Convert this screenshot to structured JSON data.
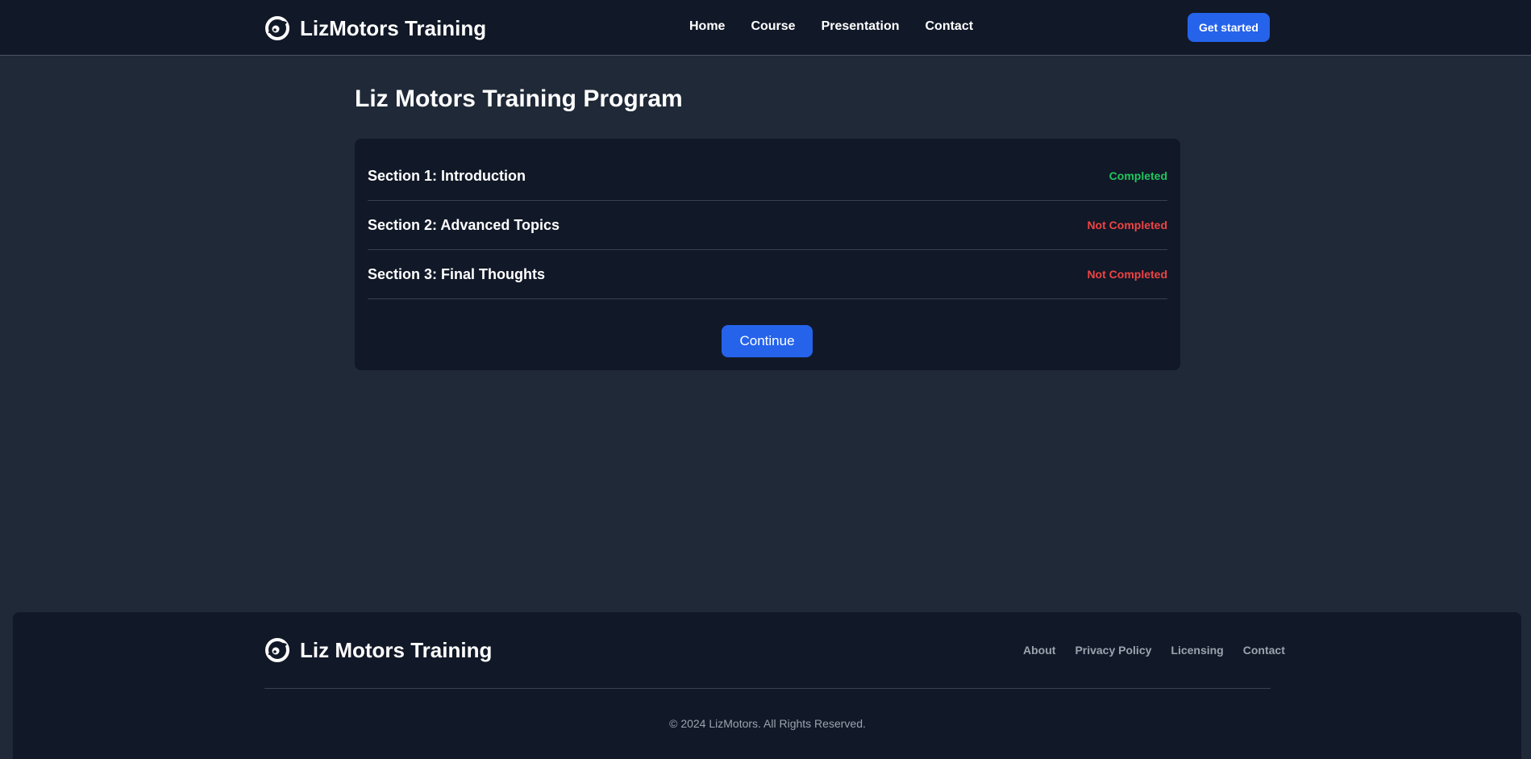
{
  "header": {
    "logo_icon": "swirl-logo-icon",
    "brand": "LizMotors Training",
    "nav": [
      "Home",
      "Course",
      "Presentation",
      "Contact"
    ],
    "cta_label": "Get started"
  },
  "main": {
    "title": "Liz Motors Training Program",
    "sections": [
      {
        "title": "Section 1: Introduction",
        "status": "Completed",
        "status_color": "#22c55e"
      },
      {
        "title": "Section 2: Advanced Topics",
        "status": "Not Completed",
        "status_color": "#ef4444"
      },
      {
        "title": "Section 3: Final Thoughts",
        "status": "Not Completed",
        "status_color": "#ef4444"
      }
    ],
    "continue_label": "Continue"
  },
  "footer": {
    "logo_icon": "swirl-logo-icon",
    "brand": "Liz Motors Training",
    "links": [
      "About",
      "Privacy Policy",
      "Licensing",
      "Contact"
    ],
    "copyright": "© 2024 LizMotors. All Rights Reserved."
  },
  "colors": {
    "accent": "#2563eb",
    "completed": "#22c55e",
    "not_completed": "#ef4444",
    "background": "#1f2937",
    "surface": "#111827"
  }
}
